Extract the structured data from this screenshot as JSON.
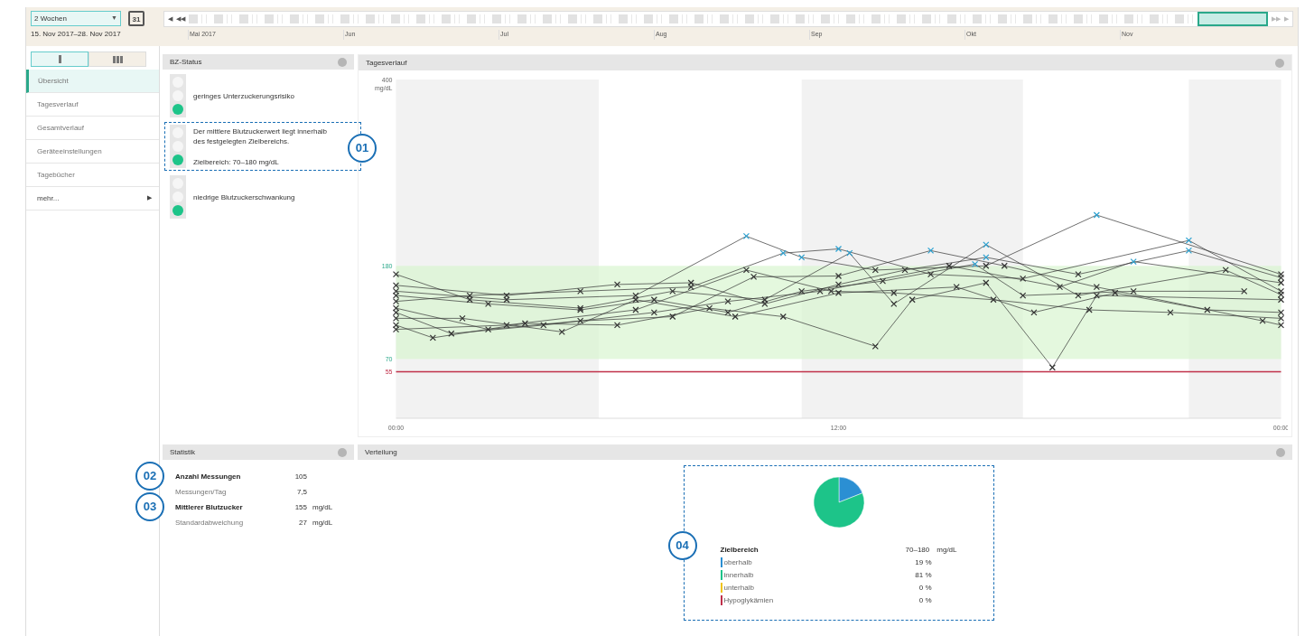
{
  "toolbar": {
    "range_select": "2 Wochen",
    "dropdown_caret": "▼",
    "calendar_day": "31",
    "date_range": "15. Nov 2017–28. Nov 2017",
    "nav_back": [
      "◀",
      "◀◀"
    ],
    "nav_forward": [
      "▶▶",
      "▶"
    ],
    "timeline_months": [
      "Mai 2017",
      "Jun",
      "Jul",
      "Aug",
      "Sep",
      "Okt",
      "Nov"
    ]
  },
  "sidebar": {
    "view_toggles": [
      {
        "kind": "single",
        "selected": true
      },
      {
        "kind": "triple",
        "selected": false
      }
    ],
    "items": [
      {
        "label": "Übersicht",
        "selected": true
      },
      {
        "label": "Tagesverlauf",
        "selected": false
      },
      {
        "label": "Gesamtverlauf",
        "selected": false
      },
      {
        "label": "Geräteeinstellungen",
        "selected": false
      },
      {
        "label": "Tagebücher",
        "selected": false
      },
      {
        "label": "mehr...",
        "selected": false,
        "arrow": "▶"
      }
    ]
  },
  "status_panel": {
    "title": "BZ-Status",
    "items": [
      {
        "lights": [
          {
            "on": false
          },
          {
            "on": false
          },
          {
            "on": true
          }
        ],
        "lines": [
          "geringes Unterzuckerungsrisiko"
        ]
      },
      {
        "lights": [
          {
            "on": false
          },
          {
            "on": false
          },
          {
            "on": true
          }
        ],
        "lines": [
          "Der mittlere Blutzuckerwert liegt innerhalb des festgelegten Zielbereichs.",
          "Zielbereich: 70–180 mg/dL"
        ],
        "callout": "01"
      },
      {
        "lights": [
          {
            "on": false
          },
          {
            "on": false
          },
          {
            "on": true
          }
        ],
        "lines": [
          "niedrige Blutzuckerschwankung"
        ]
      }
    ]
  },
  "daily_panel": {
    "title": "Tagesverlauf",
    "chart_data": {
      "type": "line",
      "ylabel": "mg/dL",
      "xlim": [
        0,
        24
      ],
      "ylim": [
        0,
        400
      ],
      "xticks": [
        {
          "value": 0,
          "label": "00:00"
        },
        {
          "value": 12,
          "label": "12:00"
        },
        {
          "value": 24,
          "label": "00:00"
        }
      ],
      "yticks": [
        400,
        180,
        70,
        55
      ],
      "bands": [
        {
          "axis": "y",
          "from": 70,
          "to": 180,
          "color": "#d9f5d0"
        },
        {
          "axis": "x",
          "from": 0,
          "to": 5.5,
          "color": "#f2f2f2"
        },
        {
          "axis": "x",
          "from": 11,
          "to": 17,
          "color": "#f2f2f2"
        },
        {
          "axis": "x",
          "from": 21.5,
          "to": 24,
          "color": "#f2f2f2"
        }
      ],
      "ref_lines": [
        {
          "axis": "y",
          "value": 55,
          "color": "#c0304a"
        }
      ],
      "series": [
        {
          "color": "#333333",
          "marker": "x",
          "x": [
            0,
            3,
            6.5,
            9.5,
            11,
            13,
            16,
            19,
            24
          ],
          "values": [
            150,
            140,
            145,
            215,
            190,
            175,
            180,
            240,
            170
          ]
        },
        {
          "color": "#333333",
          "marker": "x",
          "x": [
            0,
            2,
            5,
            8,
            10.5,
            12,
            14.5,
            17,
            21.5,
            24
          ],
          "values": [
            138,
            145,
            150,
            155,
            195,
            200,
            170,
            165,
            210,
            150
          ]
        },
        {
          "color": "#333333",
          "marker": "x",
          "x": [
            0,
            1.5,
            4,
            7,
            9,
            11.5,
            15,
            18,
            20,
            24
          ],
          "values": [
            125,
            100,
            110,
            125,
            138,
            150,
            180,
            155,
            185,
            160
          ]
        },
        {
          "color": "#333333",
          "marker": "x",
          "x": [
            0,
            1,
            3.5,
            6,
            8.5,
            10.5,
            13,
            14,
            16,
            17.8,
            19,
            24
          ],
          "values": [
            110,
            95,
            112,
            110,
            130,
            120,
            85,
            140,
            160,
            60,
            145,
            140
          ]
        },
        {
          "color": "#333333",
          "marker": "x",
          "x": [
            0,
            2,
            5,
            7.5,
            10,
            12.3,
            13.5,
            16,
            18.5,
            22.5,
            24
          ],
          "values": [
            170,
            140,
            130,
            150,
            140,
            195,
            135,
            205,
            145,
            175,
            146
          ]
        },
        {
          "color": "#333333",
          "marker": "x",
          "x": [
            0,
            2.5,
            5,
            7,
            9,
            11,
            13.2,
            15.7,
            17,
            20,
            23
          ],
          "values": [
            145,
            135,
            128,
            140,
            125,
            150,
            162,
            182,
            145,
            150,
            150
          ]
        },
        {
          "color": "#333333",
          "marker": "x",
          "x": [
            0,
            3,
            6,
            8,
            10,
            12,
            13.8,
            16,
            18.5,
            21.5,
            24
          ],
          "values": [
            157,
            145,
            158,
            160,
            135,
            158,
            175,
            190,
            170,
            198,
            166
          ]
        },
        {
          "color": "#333333",
          "marker": "x",
          "x": [
            0,
            1.8,
            4.5,
            6.5,
            9.2,
            12,
            15.2,
            17.3,
            19.5,
            22,
            24
          ],
          "values": [
            118,
            118,
            102,
            140,
            120,
            148,
            155,
            125,
            148,
            128,
            125
          ]
        },
        {
          "color": "#333333",
          "marker": "x",
          "x": [
            0,
            2.5,
            5,
            7.5,
            9.7,
            12,
            14.5,
            16.5,
            19,
            23.5,
            24
          ],
          "values": [
            130,
            105,
            115,
            120,
            167,
            168,
            198,
            180,
            155,
            115,
            110
          ]
        },
        {
          "color": "#333333",
          "marker": "x",
          "x": [
            0,
            3,
            6.5,
            9.5,
            11.8,
            13.5,
            16.2,
            18.8,
            21,
            24
          ],
          "values": [
            105,
            110,
            128,
            175,
            150,
            148,
            140,
            128,
            125,
            118
          ]
        }
      ]
    }
  },
  "stats_panel": {
    "title": "Statistik",
    "rows": [
      {
        "label": "Anzahl Messungen",
        "value": "105",
        "bold": true,
        "callout": "02"
      },
      {
        "label": "Messungen/Tag",
        "value": "7,5",
        "bold": false
      },
      {
        "label": "Mittlerer Blutzucker",
        "value": "155",
        "unit": "mg/dL",
        "bold": true,
        "callout": "03"
      },
      {
        "label": "Standardabweichung",
        "value": "27",
        "unit": "mg/dL",
        "bold": false
      }
    ]
  },
  "distribution_panel": {
    "title": "Verteilung",
    "callout": "04",
    "heading": "Zielbereich",
    "range": "70–180",
    "unit": "mg/dL",
    "chart_data": {
      "type": "pie",
      "categories": [
        "oberhalb",
        "innerhalb",
        "unterhalb",
        "Hypoglykämien"
      ],
      "values": [
        19,
        81,
        0,
        0
      ]
    },
    "legend": [
      {
        "value": "19 %",
        "color": "#2b8fd3"
      },
      {
        "value": "81 %",
        "color": "#1dc489"
      },
      {
        "value": "0 %",
        "color": "#f0c419"
      },
      {
        "value": "0 %",
        "color": "#c0304a"
      }
    ]
  }
}
